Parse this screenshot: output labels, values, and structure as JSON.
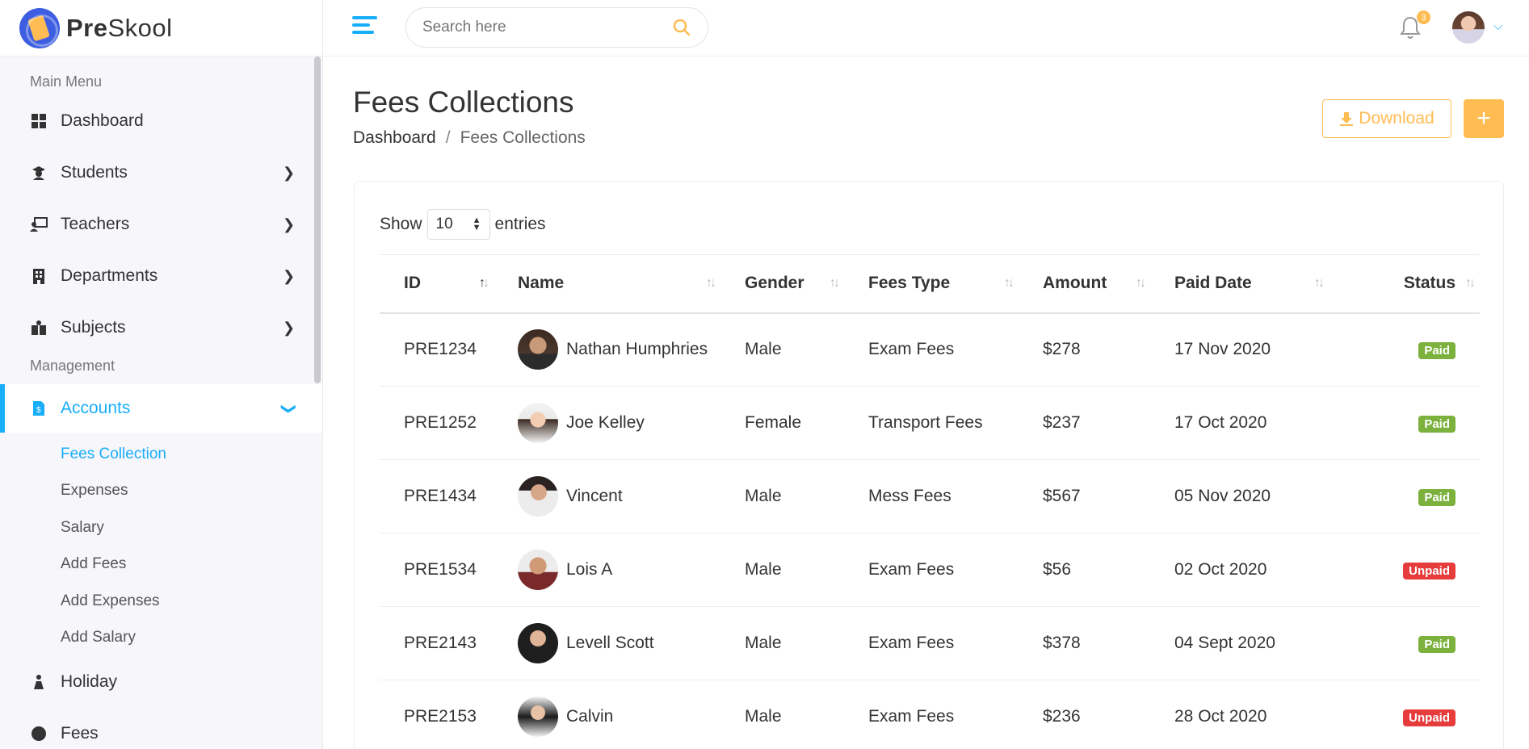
{
  "brand": {
    "name_bold": "Pre",
    "name_light": "Skool"
  },
  "header": {
    "search_placeholder": "Search here",
    "notification_count": "3"
  },
  "sidebar": {
    "section_main": "Main Menu",
    "items": [
      {
        "label": "Dashboard",
        "icon": "dashboard-icon"
      },
      {
        "label": "Students",
        "icon": "student-icon"
      },
      {
        "label": "Teachers",
        "icon": "teacher-icon"
      },
      {
        "label": "Departments",
        "icon": "building-icon"
      },
      {
        "label": "Subjects",
        "icon": "book-icon"
      }
    ],
    "section_management": "Management",
    "accounts": {
      "label": "Accounts",
      "icon": "invoice-icon"
    },
    "sub_items": [
      "Fees Collection",
      "Expenses",
      "Salary",
      "Add Fees",
      "Add Expenses",
      "Add Salary"
    ],
    "holiday": {
      "label": "Holiday",
      "icon": "holiday-icon"
    },
    "fees": {
      "label": "Fees",
      "icon": "coin-icon"
    }
  },
  "page": {
    "title": "Fees Collections",
    "breadcrumb_home": "Dashboard",
    "breadcrumb_sep": "/",
    "breadcrumb_current": "Fees Collections",
    "download_label": "Download",
    "add_label": "+"
  },
  "table": {
    "show_label": "Show",
    "entries_value": "10",
    "entries_label": "entries",
    "columns": [
      "ID",
      "Name",
      "Gender",
      "Fees Type",
      "Amount",
      "Paid Date",
      "Status"
    ],
    "rows": [
      {
        "id": "PRE1234",
        "name": "Nathan Humphries",
        "gender": "Male",
        "fees_type": "Exam Fees",
        "amount": "$278",
        "paid_date": "17 Nov 2020",
        "status": "Paid"
      },
      {
        "id": "PRE1252",
        "name": "Joe Kelley",
        "gender": "Female",
        "fees_type": "Transport Fees",
        "amount": "$237",
        "paid_date": "17 Oct 2020",
        "status": "Paid"
      },
      {
        "id": "PRE1434",
        "name": "Vincent",
        "gender": "Male",
        "fees_type": "Mess Fees",
        "amount": "$567",
        "paid_date": "05 Nov 2020",
        "status": "Paid"
      },
      {
        "id": "PRE1534",
        "name": "Lois A",
        "gender": "Male",
        "fees_type": "Exam Fees",
        "amount": "$56",
        "paid_date": "02 Oct 2020",
        "status": "Unpaid"
      },
      {
        "id": "PRE2143",
        "name": "Levell Scott",
        "gender": "Male",
        "fees_type": "Exam Fees",
        "amount": "$378",
        "paid_date": "04 Sept 2020",
        "status": "Paid"
      },
      {
        "id": "PRE2153",
        "name": "Calvin",
        "gender": "Male",
        "fees_type": "Exam Fees",
        "amount": "$236",
        "paid_date": "28 Oct 2020",
        "status": "Unpaid"
      }
    ]
  },
  "colors": {
    "accent": "#18aefa",
    "warning": "#ffbc53",
    "paid": "#7bb13c",
    "unpaid": "#e63c3c"
  }
}
